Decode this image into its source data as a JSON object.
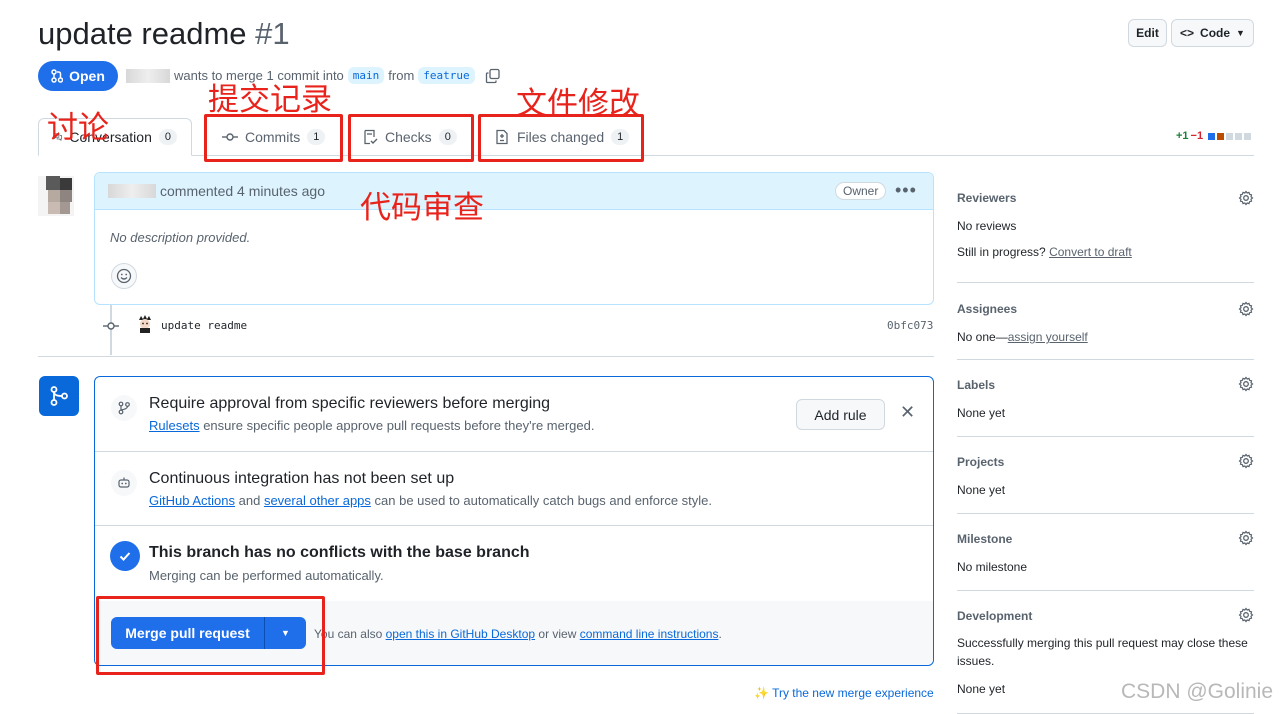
{
  "header": {
    "title": "update readme",
    "number": "#1",
    "edit_label": "Edit",
    "code_label": "Code"
  },
  "state": {
    "badge": "Open",
    "meta_text": "wants to merge 1 commit into",
    "base_branch": "main",
    "from_text": "from",
    "head_branch": "featrue"
  },
  "tabs": [
    {
      "label": "Conversation",
      "count": "0"
    },
    {
      "label": "Commits",
      "count": "1"
    },
    {
      "label": "Checks",
      "count": "0"
    },
    {
      "label": "Files changed",
      "count": "1"
    }
  ],
  "diffstat": {
    "additions": "+1",
    "deletions": "−1"
  },
  "annotations": {
    "discussion": "讨论",
    "commits": "提交记录",
    "files": "文件修改",
    "review": "代码审查"
  },
  "comment": {
    "time": "commented 4 minutes ago",
    "badge": "Owner",
    "body": "No description provided."
  },
  "commit": {
    "message": "update readme",
    "sha": "0bfc073"
  },
  "merge": {
    "rule_title": "Require approval from specific reviewers before merging",
    "rule_link": "Rulesets",
    "rule_sub": "ensure specific people approve pull requests before they're merged.",
    "add_rule": "Add rule",
    "ci_title": "Continuous integration has not been set up",
    "ci_link1": "GitHub Actions",
    "ci_and": "and",
    "ci_link2": "several other apps",
    "ci_sub": "can be used to automatically catch bugs and enforce style.",
    "ok_title": "This branch has no conflicts with the base branch",
    "ok_sub": "Merging can be performed automatically.",
    "button": "Merge pull request",
    "alt_prefix": "You can also",
    "alt_link1": "open this in GitHub Desktop",
    "alt_mid": "or view",
    "alt_link2": "command line instructions",
    "alt_suffix": ".",
    "try_new": "Try the new merge experience"
  },
  "sidebar": {
    "reviewers": {
      "title": "Reviewers",
      "value": "No reviews",
      "progress": "Still in progress?",
      "draft_link": "Convert to draft"
    },
    "assignees": {
      "title": "Assignees",
      "value": "No one—",
      "link": "assign yourself"
    },
    "labels": {
      "title": "Labels",
      "value": "None yet"
    },
    "projects": {
      "title": "Projects",
      "value": "None yet"
    },
    "milestone": {
      "title": "Milestone",
      "value": "No milestone"
    },
    "development": {
      "title": "Development",
      "value": "Successfully merging this pull request may close these issues.",
      "value2": "None yet"
    }
  },
  "watermark": "CSDN @Golinie",
  "colors": {
    "accent": "#0969da",
    "primary_button": "#1f6feb",
    "annotation_red": "#e8231b"
  }
}
